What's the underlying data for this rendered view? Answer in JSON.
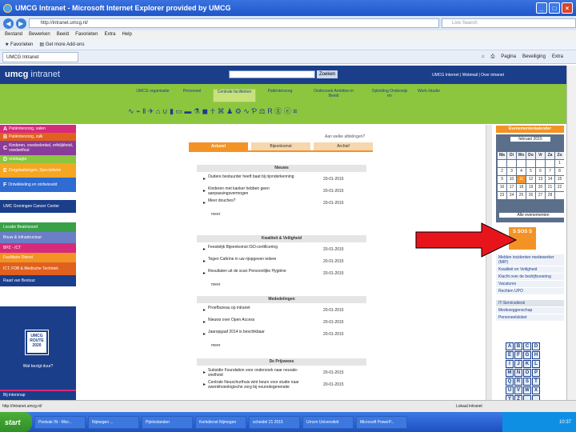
{
  "browser": {
    "title": "UMCG Intranet - Microsoft Internet Explorer provided by UMCG",
    "address": "http://intranet.umcg.nl/",
    "search_placeholder": "Live Search",
    "menu": [
      "Bestand",
      "Bewerken",
      "Beeld",
      "Favorieten",
      "Extra",
      "Help"
    ],
    "favorites_label": "Favorieten",
    "addons_label": "Get more Add-ons",
    "tab_label": "UMCG Intranet",
    "cmd_items": [
      "Pagina",
      "Beveiliging",
      "Extra"
    ]
  },
  "header": {
    "logo_main": "umcg",
    "logo_sub": " intranet",
    "search_button": "Zoeken",
    "links": "UMCG Internet | Webmail | Over intranet"
  },
  "green_nav": {
    "items": [
      "UMCG organisatie",
      "Personeel",
      "Centrale faciliteiten",
      "Patiëntenzorg",
      "Onderzoek Ambities in Beeld",
      "Opleiding Onderwijs en",
      "Werk-/studie"
    ],
    "icons": "∿ ⌁ Ⅱ ✈ ⌂ ∪ ▮ ▭ ▬ ⚗ ◼ ☥ ⌘ ♟ ⚙ ∿ Ƥ ⚖ R ⓖ ⓔ ≡"
  },
  "left_sidebar": {
    "items": [
      {
        "letter": "A",
        "label": "Patiëntenzorg, vaten",
        "color": "#d62b7a"
      },
      {
        "letter": "B",
        "label": "Patiëntenzorg, zalk",
        "color": "#e0601e"
      },
      {
        "letter": "C",
        "label": "Kinderen, voedselonkel, erfelijkheid, voedselfout",
        "color": "#8a3c9a"
      },
      {
        "letter": "D",
        "label": "ontdaagte",
        "color": "#8cc63f"
      },
      {
        "letter": "E",
        "label": "Zorgplaatsingen, Specialisme",
        "color": "#f5a623"
      },
      {
        "letter": "F",
        "label": "Ontwikkeling en stofwisseld",
        "color": "#2e6bd2"
      },
      {
        "letter": "",
        "label": "UMC Groningen Cancer Center",
        "color": "#1a3e8a"
      },
      {
        "letter": "",
        "label": "Locatie Beatrixoord",
        "color": "#3aa048"
      },
      {
        "letter": "",
        "label": "Bouw & Infrastructuur",
        "color": "#6b7ec8"
      },
      {
        "letter": "",
        "label": "BPZ - ICT",
        "color": "#d62b7a"
      },
      {
        "letter": "",
        "label": "Facilitaire Dienst",
        "color": "#f39325"
      },
      {
        "letter": "",
        "label": "ICT, FDB & Medische Techniek",
        "color": "#e0601e"
      },
      {
        "letter": "",
        "label": "Raad van Bestuur",
        "color": "#1a3e8a"
      }
    ],
    "badge_2020": "UMCG ROUTE 2020",
    "wat_text": "Wat bezigt duur?",
    "bottom_label": "Bij intersnap"
  },
  "main": {
    "top_link": "Aan welke afdelingen?",
    "tabs": [
      "Actueel",
      "Bijeenkomst",
      "Archief"
    ],
    "sections": [
      {
        "title": "Nieuws",
        "rows": [
          {
            "title": "Oudere bestuurder heeft baat bij rijonderkenning",
            "date": "20-01-2015"
          },
          {
            "title": "Kinderen met kanker hebben geen aanpassingsvermogen",
            "date": "20-01-2015"
          },
          {
            "title": "Meer douches?",
            "date": "20-01-2015"
          }
        ]
      },
      {
        "title": "Kwaliteit & Veiligheid",
        "rows": [
          {
            "title": "Feestelijk Bijeenkomst ISO-certificering",
            "date": "20-01-2015"
          },
          {
            "title": "Tegen Cafeïne in uw rijopgeven iedere",
            "date": "20-01-2015"
          },
          {
            "title": "Resultaten uit de scan Persoonlijke Hygiëne",
            "date": "20-01-2015"
          }
        ]
      },
      {
        "title": "Mededelingen",
        "rows": [
          {
            "title": "Proefbureau op intranet",
            "date": "20-01-2015"
          },
          {
            "title": "Nieuws over Open Access",
            "date": "20-01-2015"
          },
          {
            "title": "Jaaropgaaf 2014 is beschikbaar",
            "date": "20-01-2015"
          }
        ]
      },
      {
        "title": "De Prijswees",
        "rows": [
          {
            "title": "Subsidie Foundation voor onderzoek naar neurale-snelheid",
            "date": "20-01-2015"
          },
          {
            "title": "Centrale Neuschurthuis wint beurs voor studie naar zwenkhoeologische zorg bij neurodegeneratie",
            "date": "20-01-2015"
          }
        ]
      }
    ],
    "meer_label": "meer"
  },
  "right_sidebar": {
    "events_header": "Evenementenkalender",
    "month": "februari 2015",
    "weekdays": [
      "Ma",
      "Di",
      "Wo",
      "Do",
      "Vr",
      "Za",
      "Zo"
    ],
    "days": [
      "",
      "",
      "",
      "",
      "",
      "",
      "1",
      "2",
      "3",
      "4",
      "5",
      "6",
      "7",
      "8",
      "9",
      "10",
      "11",
      "12",
      "13",
      "14",
      "15",
      "16",
      "17",
      "18",
      "19",
      "20",
      "21",
      "22",
      "23",
      "24",
      "25",
      "26",
      "27",
      "28",
      ""
    ],
    "highlight_day": "11",
    "all_events": "Alle evenementen",
    "sos_text": "S SOS S",
    "links": [
      "Melden incidenten medewerker (MIP)",
      "Kwaliteit en Veiligheid",
      "Klacht over de bedrijfsvoering",
      "Vacatures",
      "Rechten UPO",
      "IT-Servicedesk",
      "Medezeggenschap",
      "Personeelsloket"
    ],
    "letters": [
      "A",
      "B",
      "C",
      "D",
      "E",
      "F",
      "G",
      "H",
      "I",
      "J",
      "K",
      "L",
      "M",
      "N",
      "O",
      "P",
      "Q",
      "R",
      "S",
      "T",
      "U",
      "V",
      "W",
      "X",
      "Y",
      "Z",
      "",
      ""
    ]
  },
  "status": {
    "url": "http://intranet.umcg.nl/",
    "zone": "Lokaal intranet"
  },
  "taskbar": {
    "start": "start",
    "items": [
      "Postvak IN - Micr...",
      "Nijmegen ...",
      "Pijnlestanden",
      "Kerkdienst Nijmegen",
      "scheidel 21 2015",
      "Umcm Universiteit",
      "Microsoft PowerP..."
    ],
    "tray": "10:37"
  },
  "colors": {
    "header_blue": "#1a3e8a",
    "nav_green": "#8cc63f",
    "accent_orange": "#f39325",
    "arrow_red": "#e8141c"
  }
}
